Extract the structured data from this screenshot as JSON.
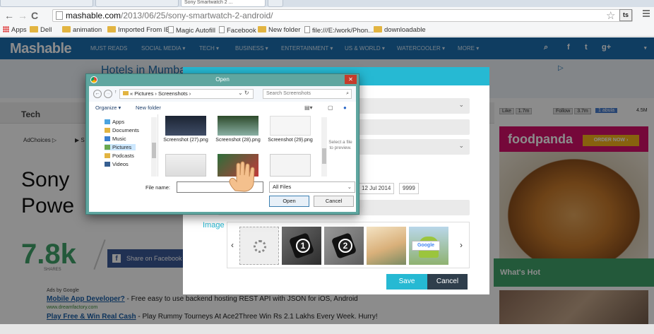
{
  "browser": {
    "tabs": [
      "",
      "",
      "Sony Smartwatch 2 ...",
      ""
    ],
    "url_host": "mashable.com",
    "url_path": "/2013/06/25/sony-smartwatch-2-android/",
    "extension_label": "ts",
    "bookmarks": [
      "Apps",
      "Dell",
      "animation",
      "Imported From IE",
      "Magic Autofill",
      "Facebook",
      "New folder",
      "file:///E:/work/Phon...",
      "downloadable"
    ]
  },
  "site": {
    "logo": "Mashable",
    "nav": [
      "MUST READS",
      "SOCIAL MEDIA ▾",
      "TECH ▾",
      "BUSINESS ▾",
      "ENTERTAINMENT ▾",
      "US & WORLD ▾",
      "WATERCOOLER ▾",
      "MORE ▾"
    ],
    "banner_ad": "Hotels in Mumba",
    "section": "Tech",
    "adchoices": "AdChoices ▷",
    "adchoices_link": "▶ S",
    "headline_line1": "Sony",
    "headline_line2": "Powe",
    "shares_count": "7.8k",
    "shares_label": "SHARES",
    "share_facebook": "Share on Facebook",
    "ads_by": "Ads by Google",
    "ad1_title": "Mobile App Developer?",
    "ad1_text": " - Free easy to use backend hosting REST API with JSON for iOS, Android",
    "ad1_url": "www.dreamfactory.com",
    "ad2_title": "Play Free & Win Real Cash",
    "ad2_text": " - Play Rummy Tourneys At Ace2Three Win Rs 2.1 Lakhs Every Week. Hurry!",
    "social": {
      "like": "Like",
      "like_count": "1.7m",
      "follow": "Follow",
      "follow_count": "3.7m",
      "gplus": "1 abula",
      "gplus_count": "4.5M"
    },
    "foodpanda_logo": "foodpanda",
    "foodpanda_cta": "ORDER NOW ›",
    "whats_hot": "What's Hot"
  },
  "modal": {
    "date_chip": "12 Jul 2014",
    "number_chip": "9999",
    "image_label": "Image",
    "thumb_badges": [
      "1",
      "2"
    ],
    "thumb_sign": "Google",
    "save": "Save",
    "cancel": "Cancel"
  },
  "dialog": {
    "title": "Open",
    "breadcrumb": "« Pictures › Screenshots ›",
    "search_placeholder": "Search Screenshots",
    "organize": "Organize ▾",
    "new_folder": "New folder",
    "nav_items": [
      "Apps",
      "Documents",
      "Music",
      "Pictures",
      "Podcasts",
      "Videos"
    ],
    "files": [
      "Screenshot (27).png",
      "Screenshot (28).png",
      "Screenshot (29).png"
    ],
    "preview_text": "Select a file to preview.",
    "file_name_label": "File name:",
    "file_name_value": "",
    "filter": "All Files",
    "open": "Open",
    "cancel": "Cancel"
  },
  "colors": {
    "mashable_blue": "#1d6fb1",
    "modal_accent": "#26b9d3",
    "modal_dark": "#2f3e4c",
    "share_green": "#40a26a"
  }
}
